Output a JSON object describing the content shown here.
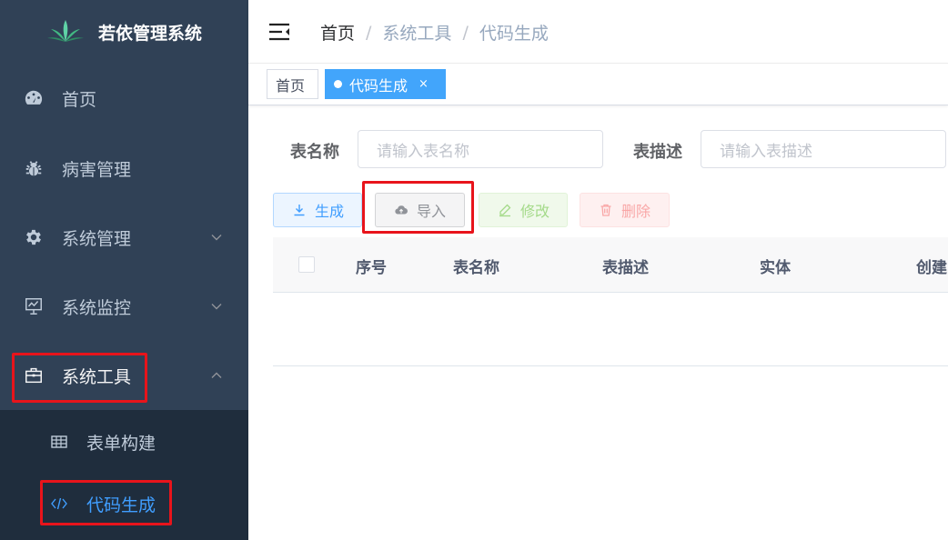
{
  "sidebar": {
    "app_title": "若依管理系统",
    "menu": [
      {
        "label": "首页",
        "icon": "dashboard-icon"
      },
      {
        "label": "病害管理",
        "icon": "bug-icon"
      },
      {
        "label": "系统管理",
        "icon": "gear-icon"
      },
      {
        "label": "系统监控",
        "icon": "monitor-icon"
      },
      {
        "label": "系统工具",
        "icon": "toolbox-icon"
      }
    ],
    "submenu": [
      {
        "label": "表单构建",
        "icon": "table-icon"
      },
      {
        "label": "代码生成",
        "icon": "code-icon"
      }
    ]
  },
  "navbar": {
    "breadcrumb": [
      "首页",
      "系统工具",
      "代码生成"
    ],
    "separator": "/"
  },
  "tags": [
    {
      "label": "首页"
    },
    {
      "label": "代码生成",
      "close": "×"
    }
  ],
  "search": {
    "table_name_label": "表名称",
    "table_name_placeholder": "请输入表名称",
    "table_desc_label": "表描述",
    "table_desc_placeholder": "请输入表描述"
  },
  "toolbar": {
    "generate": "生成",
    "import": "导入",
    "edit": "修改",
    "delete": "删除"
  },
  "table": {
    "columns": [
      "序号",
      "表名称",
      "表描述",
      "实体",
      "创建"
    ]
  },
  "colors": {
    "sidebar_bg": "#304156",
    "submenu_bg": "#1f2d3d",
    "accent": "#409eff",
    "highlight": "#e8141b"
  }
}
